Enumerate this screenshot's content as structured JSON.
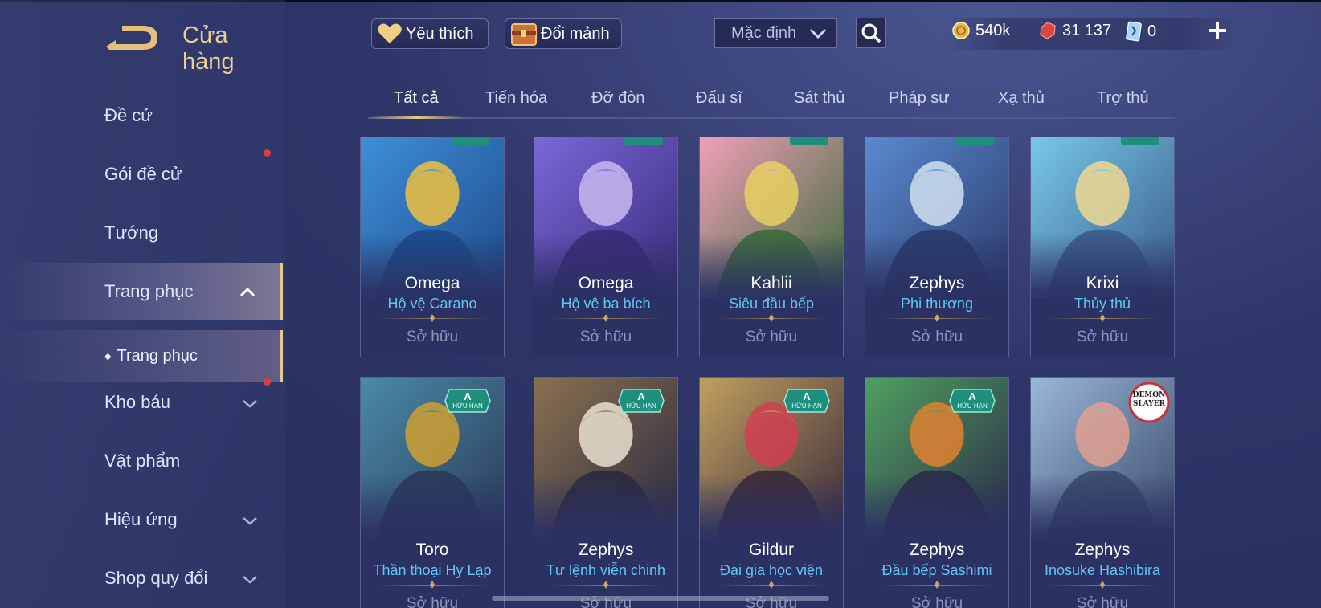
{
  "header": {
    "title": "Cửa hàng",
    "favorites_label": "Yêu thích",
    "exchange_label": "Đổi mảnh",
    "sort_value": "Mặc định"
  },
  "currency": {
    "gold": "540k",
    "vouchers": "31 137",
    "cards": "0"
  },
  "sidebar": {
    "items": [
      {
        "label": "Đề cử"
      },
      {
        "label": "Gói đề cử"
      },
      {
        "label": "Tướng"
      },
      {
        "label": "Trang phục"
      },
      {
        "label": "Kho báu"
      },
      {
        "label": "Vật phẩm"
      },
      {
        "label": "Hiệu ứng"
      },
      {
        "label": "Shop quy đổi"
      }
    ],
    "sub_item": "Trang phục"
  },
  "tabs": [
    "Tất cả",
    "Tiến hóa",
    "Đỡ đòn",
    "Đấu sĩ",
    "Sát thủ",
    "Pháp sư",
    "Xạ thủ",
    "Trợ thủ"
  ],
  "cards": [
    {
      "hero": "Omega",
      "skin": "Hộ vệ Carano",
      "status": "Sở hữu"
    },
    {
      "hero": "Omega",
      "skin": "Hộ vệ ba bích",
      "status": "Sở hữu"
    },
    {
      "hero": "Kahlii",
      "skin": "Siêu đầu bếp",
      "status": "Sở hữu"
    },
    {
      "hero": "Zephys",
      "skin": "Phi thương",
      "status": "Sở hữu"
    },
    {
      "hero": "Krixi",
      "skin": "Thủy thủ",
      "status": "Sở hữu"
    },
    {
      "hero": "Toro",
      "skin": "Thần thoại Hy Lạp",
      "status": "Sở hữu",
      "badge": "A"
    },
    {
      "hero": "Zephys",
      "skin": "Tư lệnh viễn chinh",
      "status": "Sở hữu",
      "badge": "A"
    },
    {
      "hero": "Gildur",
      "skin": "Đại gia học viện",
      "status": "Sở hữu",
      "badge": "A"
    },
    {
      "hero": "Zephys",
      "skin": "Đầu bếp Sashimi",
      "status": "Sở hữu",
      "badge": "A"
    },
    {
      "hero": "Zephys",
      "skin": "Inosuke Hashibira",
      "status": "Sở hữu"
    }
  ],
  "badge_sub": "HỮU HẠN",
  "demon_logo": "DEMON SLAYER",
  "colors": {
    "accent_gold": "#e8cf92",
    "skin_blue": "#5fc7f2",
    "badge_teal": "#1f8f7d",
    "notification_red": "#e8393a"
  },
  "icons": {
    "back": "back-arrow-icon",
    "favorites": "heart-icon",
    "exchange": "chest-icon",
    "sort": "chevron-down-icon",
    "search": "search-icon",
    "gold": "gold-coin-icon",
    "vouchers": "red-gem-icon",
    "cards": "card-icon",
    "add": "plus-icon"
  }
}
